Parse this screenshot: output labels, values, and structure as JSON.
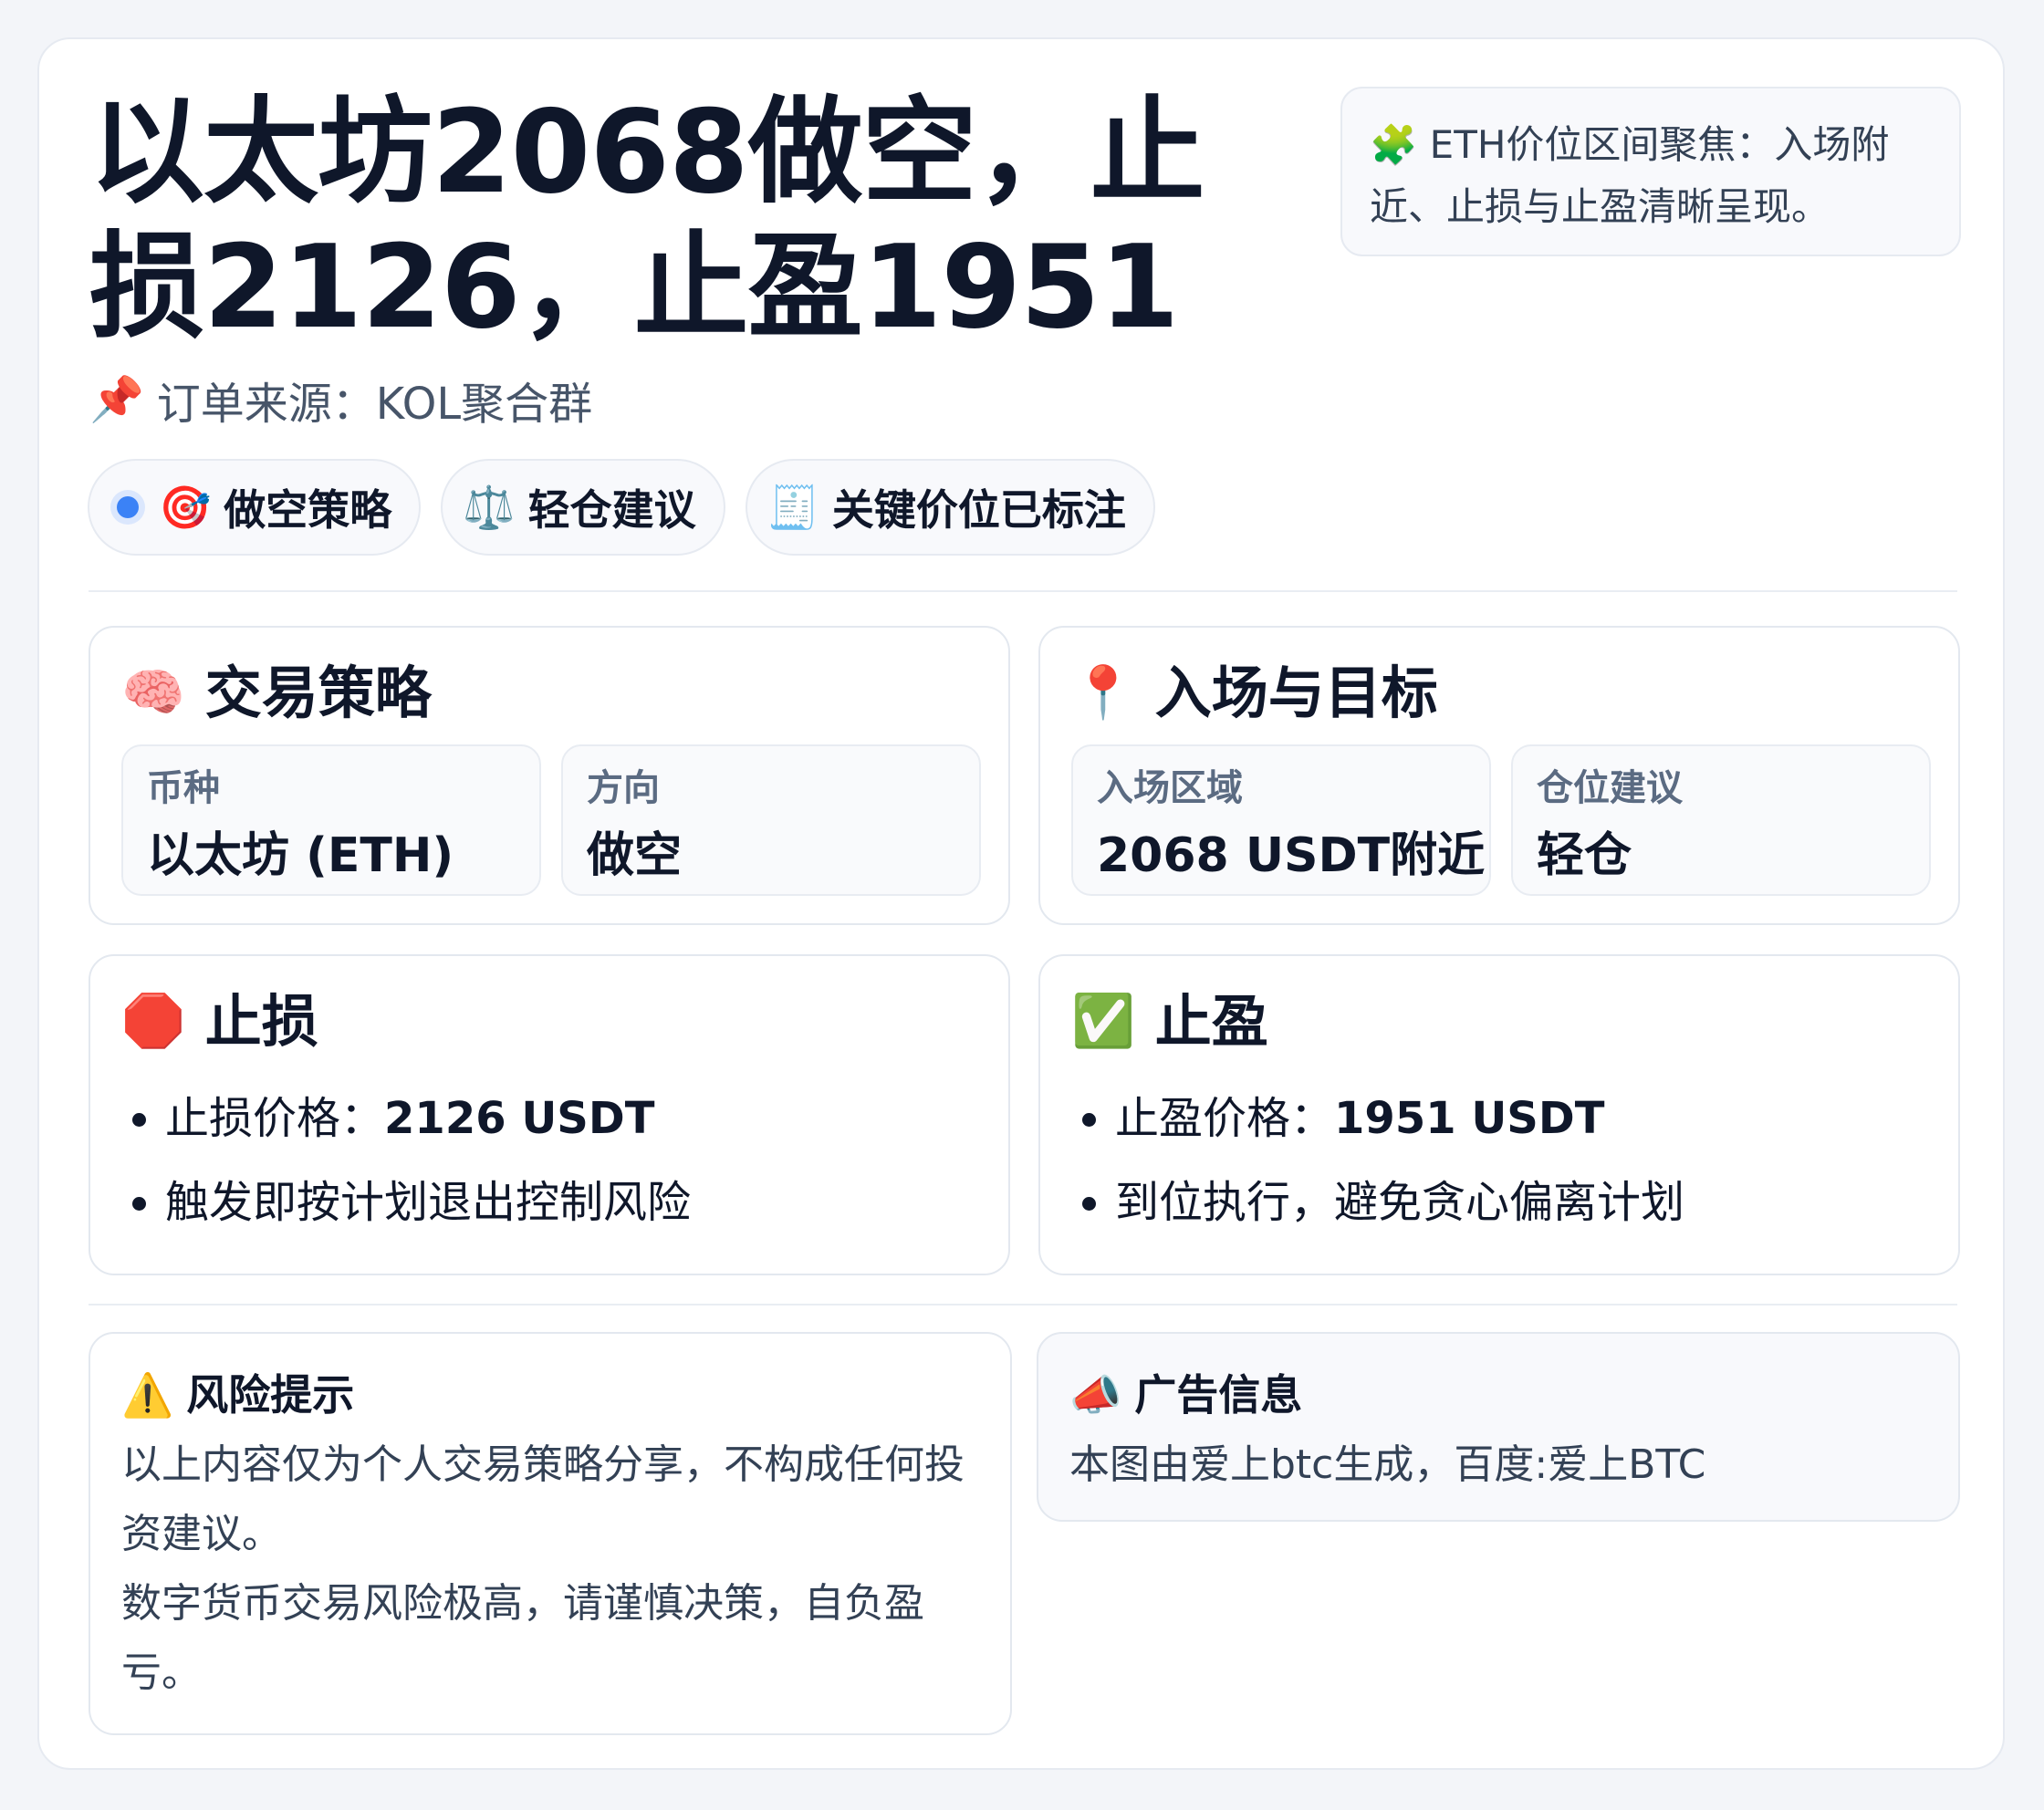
{
  "header": {
    "title": "以太坊2068做空，止损2126，止盈1951",
    "note": "ETH价位区间聚焦：入场附近、止损与止盈清晰呈现。",
    "source": "订单来源：KOL聚合群"
  },
  "chips": [
    {
      "icon": "target-icon",
      "label": "做空策略"
    },
    {
      "icon": "balance-scale-icon",
      "label": "轻仓建议"
    },
    {
      "icon": "receipt-icon",
      "label": "关键价位已标注"
    }
  ],
  "strategy": {
    "title": "交易策略",
    "coin_label": "币种",
    "coin_value": "以太坊 (ETH)",
    "direction_label": "方向",
    "direction_value": "做空"
  },
  "entry": {
    "title": "入场与目标",
    "zone_label": "入场区域",
    "zone_value": "2068 USDT附近",
    "position_label": "仓位建议",
    "position_value": "轻仓"
  },
  "stop_loss": {
    "title": "止损",
    "price_label": "止损价格：",
    "price_value": "2126 USDT",
    "note": "触发即按计划退出控制风险"
  },
  "take_profit": {
    "title": "止盈",
    "price_label": "止盈价格：",
    "price_value": "1951 USDT",
    "note": "到位执行，避免贪心偏离计划"
  },
  "risk": {
    "title": "风险提示",
    "line1": "以上内容仅为个人交易策略分享，不构成任何投资建议。",
    "line2": "数字货币交易风险极高，请谨慎决策，自负盈亏。"
  },
  "ad": {
    "title": "广告信息",
    "text": "本图由爱上btc生成，百度:爱上BTC"
  },
  "colors": {
    "accent": "#3b82f6",
    "background": "#f3f5f9",
    "card": "#ffffff",
    "text": "#0f172a",
    "muted": "#5b6b82"
  }
}
